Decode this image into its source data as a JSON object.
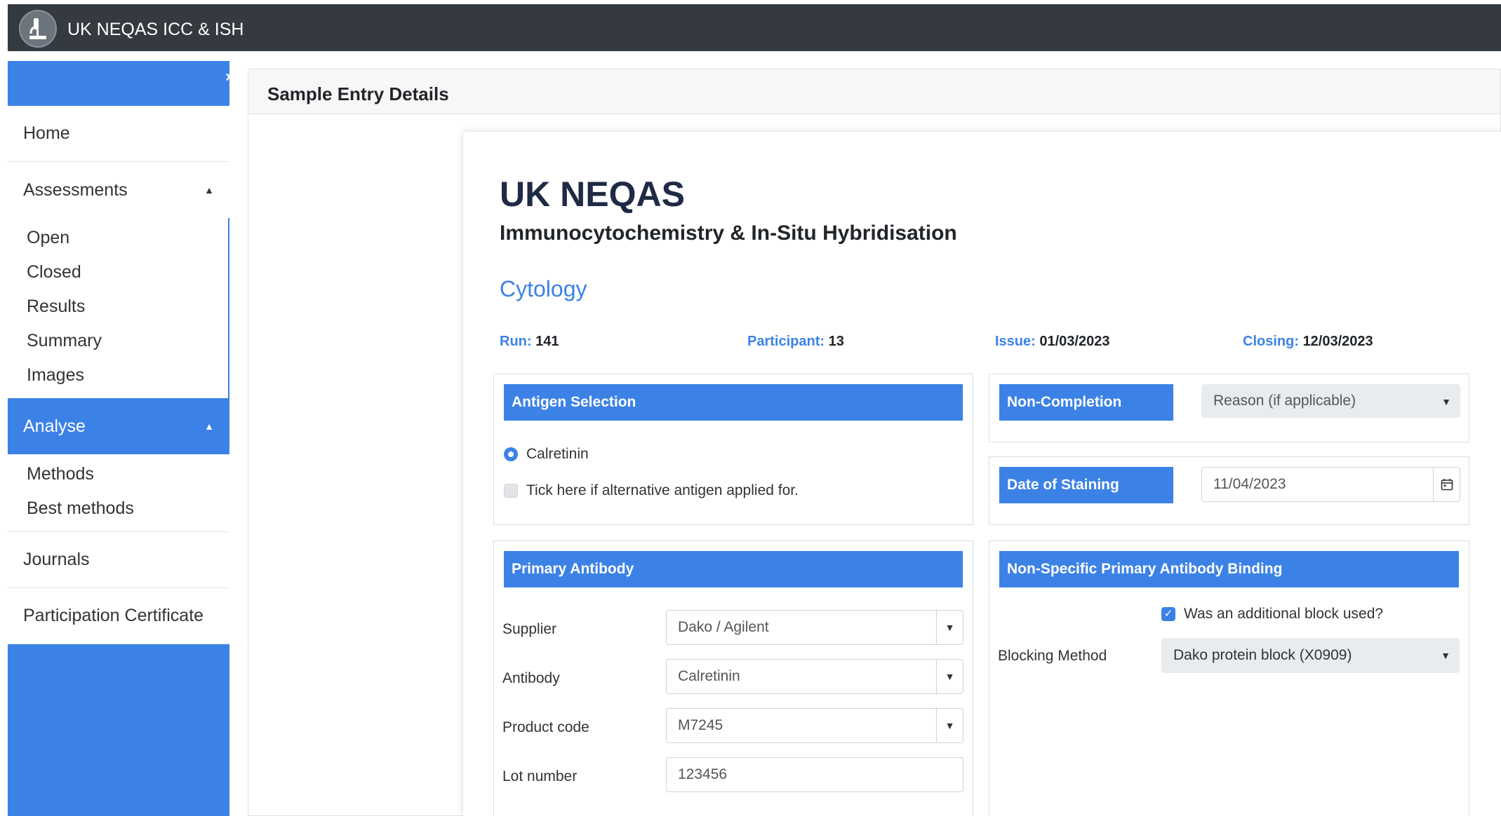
{
  "app": {
    "title": "UK NEQAS ICC & ISH"
  },
  "sidebar": {
    "toggle_icon": "chevron-right",
    "items": [
      {
        "label": "Home"
      },
      {
        "label": "Assessments",
        "expanded": true,
        "children": [
          "Open",
          "Closed",
          "Results",
          "Summary",
          "Images"
        ]
      },
      {
        "label": "Analyse",
        "expanded": true,
        "active": true,
        "children": [
          "Methods",
          "Best methods"
        ]
      },
      {
        "label": "Journals"
      },
      {
        "label": "Participation Certificate"
      }
    ]
  },
  "page": {
    "title": "Sample Entry Details"
  },
  "form": {
    "org": "UK NEQAS",
    "subtitle": "Immunocytochemistry & In-Situ Hybridisation",
    "module": "Cytology",
    "info": {
      "run_label": "Run:",
      "run_value": "141",
      "participant_label": "Participant:",
      "participant_value": "13",
      "issue_label": "Issue:",
      "issue_value": "01/03/2023",
      "closing_label": "Closing:",
      "closing_value": "12/03/2023"
    },
    "antigen": {
      "heading": "Antigen Selection",
      "selected": "Calretinin",
      "alt_checkbox_label": "Tick here if alternative antigen applied for.",
      "alt_checked": false
    },
    "non_completion": {
      "heading": "Non-Completion",
      "placeholder": "Reason (if applicable)"
    },
    "staining": {
      "heading": "Date of Staining",
      "value": "11/04/2023"
    },
    "primary_antibody": {
      "heading": "Primary Antibody",
      "supplier_label": "Supplier",
      "supplier_value": "Dako / Agilent",
      "antibody_label": "Antibody",
      "antibody_value": "Calretinin",
      "product_code_label": "Product code",
      "product_code_value": "M7245",
      "lot_number_label": "Lot number",
      "lot_number_value": "123456"
    },
    "nonspecific": {
      "heading": "Non-Specific Primary Antibody Binding",
      "additional_block_label": "Was an additional block used?",
      "additional_block_checked": true,
      "blocking_method_label": "Blocking Method",
      "blocking_method_value": "Dako protein block (X0909)"
    }
  },
  "colors": {
    "accent": "#3c82e6",
    "topbar": "#343a40",
    "heading_dark": "#1f2a44"
  }
}
